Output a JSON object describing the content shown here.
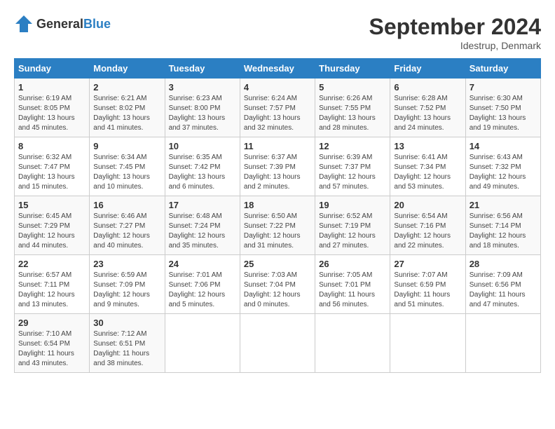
{
  "logo": {
    "general": "General",
    "blue": "Blue"
  },
  "title": "September 2024",
  "location": "Idestrup, Denmark",
  "days_of_week": [
    "Sunday",
    "Monday",
    "Tuesday",
    "Wednesday",
    "Thursday",
    "Friday",
    "Saturday"
  ],
  "weeks": [
    [
      {
        "day": "1",
        "sunrise": "6:19 AM",
        "sunset": "8:05 PM",
        "daylight": "13 hours and 45 minutes."
      },
      {
        "day": "2",
        "sunrise": "6:21 AM",
        "sunset": "8:02 PM",
        "daylight": "13 hours and 41 minutes."
      },
      {
        "day": "3",
        "sunrise": "6:23 AM",
        "sunset": "8:00 PM",
        "daylight": "13 hours and 37 minutes."
      },
      {
        "day": "4",
        "sunrise": "6:24 AM",
        "sunset": "7:57 PM",
        "daylight": "13 hours and 32 minutes."
      },
      {
        "day": "5",
        "sunrise": "6:26 AM",
        "sunset": "7:55 PM",
        "daylight": "13 hours and 28 minutes."
      },
      {
        "day": "6",
        "sunrise": "6:28 AM",
        "sunset": "7:52 PM",
        "daylight": "13 hours and 24 minutes."
      },
      {
        "day": "7",
        "sunrise": "6:30 AM",
        "sunset": "7:50 PM",
        "daylight": "13 hours and 19 minutes."
      }
    ],
    [
      {
        "day": "8",
        "sunrise": "6:32 AM",
        "sunset": "7:47 PM",
        "daylight": "13 hours and 15 minutes."
      },
      {
        "day": "9",
        "sunrise": "6:34 AM",
        "sunset": "7:45 PM",
        "daylight": "13 hours and 10 minutes."
      },
      {
        "day": "10",
        "sunrise": "6:35 AM",
        "sunset": "7:42 PM",
        "daylight": "13 hours and 6 minutes."
      },
      {
        "day": "11",
        "sunrise": "6:37 AM",
        "sunset": "7:39 PM",
        "daylight": "13 hours and 2 minutes."
      },
      {
        "day": "12",
        "sunrise": "6:39 AM",
        "sunset": "7:37 PM",
        "daylight": "12 hours and 57 minutes."
      },
      {
        "day": "13",
        "sunrise": "6:41 AM",
        "sunset": "7:34 PM",
        "daylight": "12 hours and 53 minutes."
      },
      {
        "day": "14",
        "sunrise": "6:43 AM",
        "sunset": "7:32 PM",
        "daylight": "12 hours and 49 minutes."
      }
    ],
    [
      {
        "day": "15",
        "sunrise": "6:45 AM",
        "sunset": "7:29 PM",
        "daylight": "12 hours and 44 minutes."
      },
      {
        "day": "16",
        "sunrise": "6:46 AM",
        "sunset": "7:27 PM",
        "daylight": "12 hours and 40 minutes."
      },
      {
        "day": "17",
        "sunrise": "6:48 AM",
        "sunset": "7:24 PM",
        "daylight": "12 hours and 35 minutes."
      },
      {
        "day": "18",
        "sunrise": "6:50 AM",
        "sunset": "7:22 PM",
        "daylight": "12 hours and 31 minutes."
      },
      {
        "day": "19",
        "sunrise": "6:52 AM",
        "sunset": "7:19 PM",
        "daylight": "12 hours and 27 minutes."
      },
      {
        "day": "20",
        "sunrise": "6:54 AM",
        "sunset": "7:16 PM",
        "daylight": "12 hours and 22 minutes."
      },
      {
        "day": "21",
        "sunrise": "6:56 AM",
        "sunset": "7:14 PM",
        "daylight": "12 hours and 18 minutes."
      }
    ],
    [
      {
        "day": "22",
        "sunrise": "6:57 AM",
        "sunset": "7:11 PM",
        "daylight": "12 hours and 13 minutes."
      },
      {
        "day": "23",
        "sunrise": "6:59 AM",
        "sunset": "7:09 PM",
        "daylight": "12 hours and 9 minutes."
      },
      {
        "day": "24",
        "sunrise": "7:01 AM",
        "sunset": "7:06 PM",
        "daylight": "12 hours and 5 minutes."
      },
      {
        "day": "25",
        "sunrise": "7:03 AM",
        "sunset": "7:04 PM",
        "daylight": "12 hours and 0 minutes."
      },
      {
        "day": "26",
        "sunrise": "7:05 AM",
        "sunset": "7:01 PM",
        "daylight": "11 hours and 56 minutes."
      },
      {
        "day": "27",
        "sunrise": "7:07 AM",
        "sunset": "6:59 PM",
        "daylight": "11 hours and 51 minutes."
      },
      {
        "day": "28",
        "sunrise": "7:09 AM",
        "sunset": "6:56 PM",
        "daylight": "11 hours and 47 minutes."
      }
    ],
    [
      {
        "day": "29",
        "sunrise": "7:10 AM",
        "sunset": "6:54 PM",
        "daylight": "11 hours and 43 minutes."
      },
      {
        "day": "30",
        "sunrise": "7:12 AM",
        "sunset": "6:51 PM",
        "daylight": "11 hours and 38 minutes."
      },
      null,
      null,
      null,
      null,
      null
    ]
  ]
}
